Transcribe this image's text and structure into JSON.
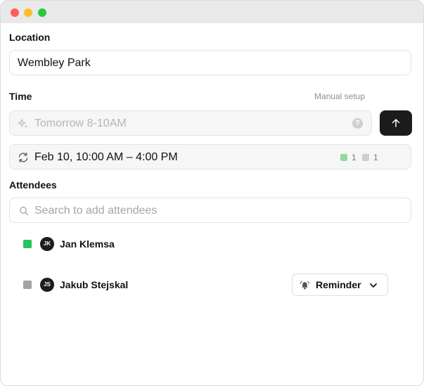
{
  "location": {
    "label": "Location",
    "value": "Wembley Park"
  },
  "time": {
    "label": "Time",
    "manual_setup_label": "Manual setup",
    "ai_placeholder": "Tomorrow 8-10AM",
    "help_glyph": "?",
    "selected_range": "Feb 10, 10:00 AM – 4:00 PM",
    "legend": [
      {
        "color": "#8bdca0",
        "count": "1"
      },
      {
        "color": "#cfcfcf",
        "count": "1"
      }
    ]
  },
  "attendees": {
    "label": "Attendees",
    "search_placeholder": "Search to add attendees",
    "list": [
      {
        "initials": "JK",
        "name": "Jan Klemsa",
        "status_color": "#22c55e"
      },
      {
        "initials": "JS",
        "name": "Jakub Stejskal",
        "status_color": "#a3a3a6",
        "action": "Reminder"
      }
    ]
  },
  "icons": {
    "ai": "sparkle-icon",
    "help": "help-icon",
    "send": "arrow-up-icon",
    "recurrence": "repeat-icon",
    "search": "search-icon",
    "reminder": "bell-icon",
    "dropdown": "chevron-down-icon"
  },
  "colors": {
    "send_button": "#1c1c1c",
    "available": "#22c55e",
    "unconfirmed": "#a3a3a6"
  }
}
